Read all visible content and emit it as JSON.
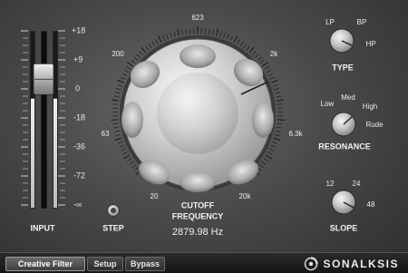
{
  "input": {
    "label": "INPUT",
    "scale": [
      "+18",
      "+9",
      "0",
      "-18",
      "-36",
      "-72",
      "-∞"
    ],
    "meter_level_left": 0.62,
    "meter_level_right": 0.62,
    "fader_level": 0.73
  },
  "cutoff": {
    "label_line1": "CUTOFF",
    "label_line2": "FREQUENCY",
    "value": "2879.98 Hz",
    "scale": [
      "20",
      "63",
      "200",
      "623",
      "2k",
      "6.3k",
      "20k"
    ]
  },
  "step": {
    "label": "STEP"
  },
  "type": {
    "label": "TYPE",
    "options": [
      "LP",
      "BP",
      "HP"
    ],
    "selected": "HP"
  },
  "resonance": {
    "label": "RESONANCE",
    "options": [
      "Low",
      "Med",
      "High",
      "Rude"
    ],
    "selected": "High"
  },
  "slope": {
    "label": "SLOPE",
    "options": [
      "12",
      "24",
      "48"
    ],
    "selected": "48"
  },
  "tabs": [
    "Creative Filter",
    "Setup",
    "Bypass"
  ],
  "active_tab": "Creative Filter",
  "brand": {
    "name": "SONALKSIS",
    "icon": "sonalksis-logo-icon"
  },
  "colors": {
    "panel": "#4a4a4a",
    "text": "#ececec",
    "meter_fill": "#d8d8d8"
  }
}
